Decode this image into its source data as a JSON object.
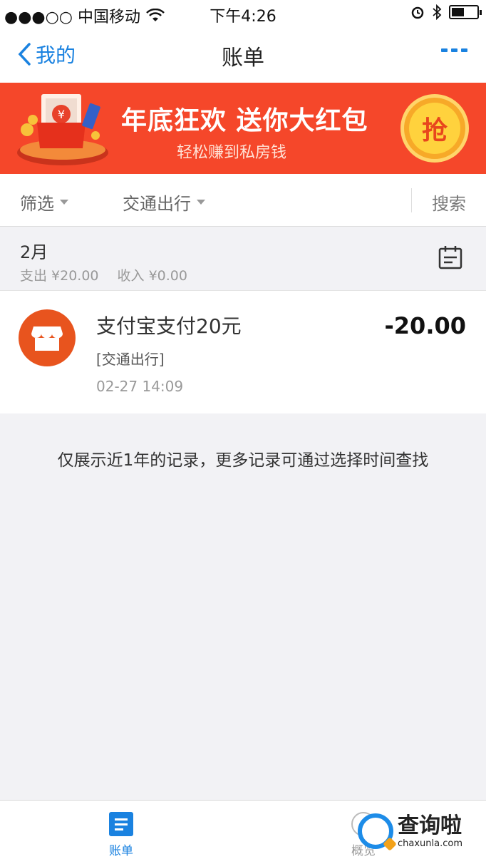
{
  "status_bar": {
    "carrier": "●●●○○ 中国移动",
    "time": "下午4:26",
    "battery_level": 0.5
  },
  "nav": {
    "back_label": "我的",
    "title": "账单"
  },
  "banner": {
    "title": "年底狂欢 送你大红包",
    "subtitle": "轻松赚到私房钱",
    "button_label": "抢",
    "currency_glyph": "¥"
  },
  "filters": {
    "filter_label": "筛选",
    "category_label": "交通出行",
    "search_label": "搜索"
  },
  "month": {
    "label": "2月",
    "expense": "支出 ¥20.00",
    "income": "收入 ¥0.00"
  },
  "bills": [
    {
      "title": "支付宝支付20元",
      "category": "[交通出行]",
      "time": "02-27  14:09",
      "amount": "-20.00",
      "icon": "shop-icon"
    }
  ],
  "notice": "仅展示近1年的记录，更多记录可通过选择时间查找",
  "tabs": [
    {
      "label": "账单",
      "icon": "bill-list-icon",
      "active": true
    },
    {
      "label": "概览",
      "icon": "overview-icon",
      "active": false
    }
  ],
  "watermark": {
    "cn": "查询啦",
    "en": "chaxunla.com"
  },
  "colors": {
    "accent": "#1a82e0",
    "banner_bg": "#f5472a",
    "shop_icon_bg": "#e8541e"
  }
}
